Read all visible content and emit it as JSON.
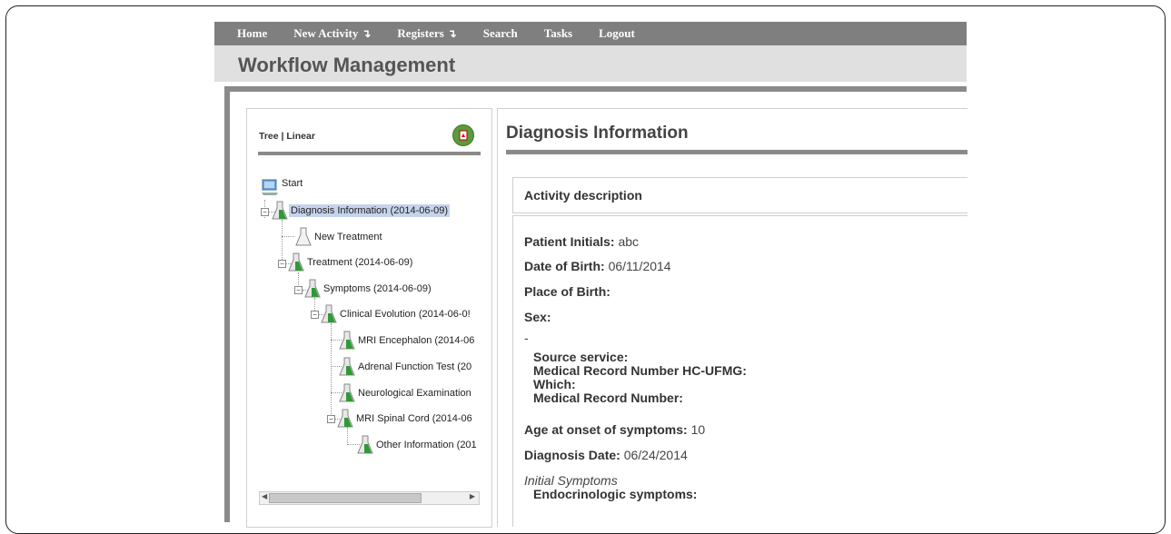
{
  "nav": {
    "items": [
      {
        "label": "Home",
        "dropdown": false
      },
      {
        "label": "New Activity",
        "dropdown": true
      },
      {
        "label": "Registers",
        "dropdown": true
      },
      {
        "label": "Search",
        "dropdown": false
      },
      {
        "label": "Tasks",
        "dropdown": false
      },
      {
        "label": "Logout",
        "dropdown": false
      }
    ],
    "dropdown_glyph": "↴"
  },
  "page_title": "Workflow Management",
  "tree_panel": {
    "view_tree": "Tree",
    "separator": " | ",
    "view_linear": "Linear",
    "pdf_icon": "pdf-export-icon",
    "nodes": {
      "start": "Start",
      "diagnosis": "Diagnosis Information (2014-06-09)",
      "new_treatment": "New Treatment",
      "treatment": "Treatment (2014-06-09)",
      "symptoms": "Symptoms (2014-06-09)",
      "clinical_evolution": "Clinical Evolution (2014-06-0!",
      "mri_encephalon": "MRI Encephalon (2014-06",
      "adrenal": "Adrenal Function Test (20",
      "neuro": "Neurological Examination",
      "mri_spinal": "MRI Spinal Cord (2014-06",
      "other_info": "Other Information (201"
    }
  },
  "detail": {
    "title": "Diagnosis Information",
    "card_header": "Activity description",
    "fields": {
      "patient_initials_label": "Patient Initials:",
      "patient_initials_value": "abc",
      "dob_label": "Date of Birth:",
      "dob_value": "06/11/2014",
      "pob_label": "Place of Birth:",
      "sex_label": "Sex:",
      "dash": "-",
      "source_service": "Source service:",
      "mrn_hc": "Medical Record Number HC-UFMG:",
      "which": "Which:",
      "mrn": "Medical Record Number:",
      "age_onset_label": "Age at onset of symptoms:",
      "age_onset_value": "10",
      "diagnosis_date_label": "Diagnosis Date:",
      "diagnosis_date_value": "06/24/2014",
      "initial_symptoms": "Initial Symptoms",
      "endocrinologic": "Endocrinologic symptoms:"
    }
  }
}
